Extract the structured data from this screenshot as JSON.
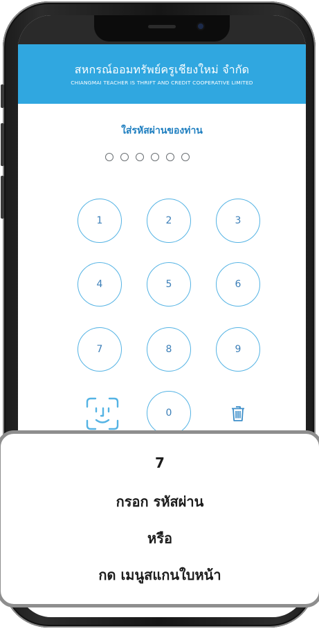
{
  "app": {
    "title": "สหกรณ์ออมทรัพย์ครูเชียงใหม่ จำกัด",
    "subtitle": "CHIANGMAI TEACHER IS THRIFT AND CREDIT COOPERATIVE LIMITED",
    "accent_color": "#30a7e0"
  },
  "pin": {
    "prompt": "ใส่รหัสผ่านของท่าน",
    "digits_entered": 0,
    "digits_total": 6
  },
  "keypad": {
    "keys": [
      "1",
      "2",
      "3",
      "4",
      "5",
      "6",
      "7",
      "8",
      "9",
      "0"
    ],
    "face_scan_icon": "face-id-icon",
    "delete_icon": "trash-icon"
  },
  "callout": {
    "step": "7",
    "line1": "กรอก รหัสผ่าน",
    "line2": "หรือ",
    "line3": "กด เมนูสแกนใบหน้า"
  }
}
